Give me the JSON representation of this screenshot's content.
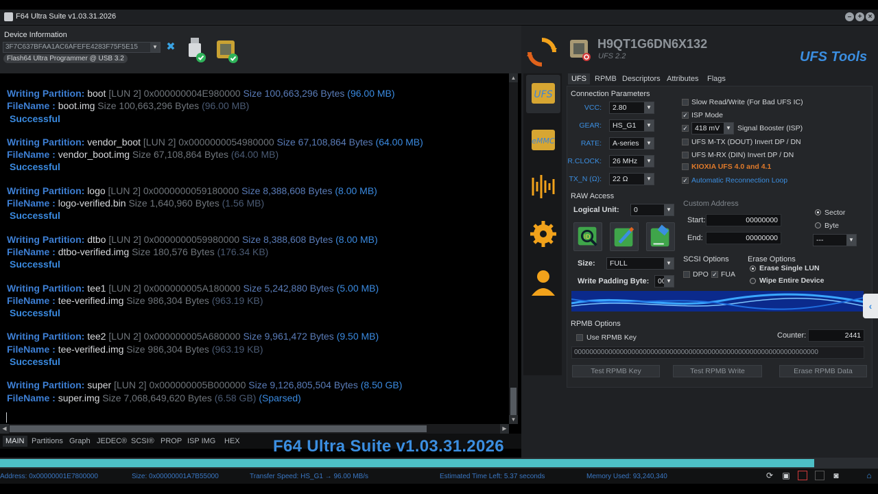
{
  "window": {
    "title": "F64 Ultra Suite v1.03.31.2026"
  },
  "device_info": {
    "label": "Device Information",
    "device_id": "3F7C637BFAA1AC6AFEFE4283F75F5E15",
    "programmer": "Flash64 Ultra Programmer @ USB 3.2"
  },
  "log": {
    "entries": [
      {
        "label": "Writing Partition:",
        "name": "boot",
        "details": "[LUN 2] 0x000000004E980000",
        "size_text": "Size 100,663,296 Bytes",
        "size_human": "(96.00 MB)",
        "file_label": "FileName :",
        "file": "boot.img",
        "file_size": "Size 100,663,296 Bytes",
        "file_human": "(96.00 MB)",
        "status": "Successful",
        "sparsed": ""
      },
      {
        "label": "Writing Partition:",
        "name": "vendor_boot",
        "details": "[LUN 2] 0x0000000054980000",
        "size_text": "Size 67,108,864 Bytes",
        "size_human": "(64.00 MB)",
        "file_label": "FileName :",
        "file": "vendor_boot.img",
        "file_size": "Size 67,108,864 Bytes",
        "file_human": "(64.00 MB)",
        "status": "Successful",
        "sparsed": ""
      },
      {
        "label": "Writing Partition:",
        "name": "logo",
        "details": "[LUN 2] 0x0000000059180000",
        "size_text": "Size 8,388,608 Bytes",
        "size_human": "(8.00 MB)",
        "file_label": "FileName :",
        "file": "logo-verified.bin",
        "file_size": "Size 1,640,960 Bytes",
        "file_human": "(1.56 MB)",
        "status": "Successful",
        "sparsed": ""
      },
      {
        "label": "Writing Partition:",
        "name": "dtbo",
        "details": "[LUN 2] 0x0000000059980000",
        "size_text": "Size 8,388,608 Bytes",
        "size_human": "(8.00 MB)",
        "file_label": "FileName :",
        "file": "dtbo-verified.img",
        "file_size": "Size 180,576 Bytes",
        "file_human": "(176.34 KB)",
        "status": "Successful",
        "sparsed": ""
      },
      {
        "label": "Writing Partition:",
        "name": "tee1",
        "details": "[LUN 2] 0x000000005A180000",
        "size_text": "Size 5,242,880 Bytes",
        "size_human": "(5.00 MB)",
        "file_label": "FileName :",
        "file": "tee-verified.img",
        "file_size": "Size 986,304 Bytes",
        "file_human": "(963.19 KB)",
        "status": "Successful",
        "sparsed": ""
      },
      {
        "label": "Writing Partition:",
        "name": "tee2",
        "details": "[LUN 2] 0x000000005A680000",
        "size_text": "Size 9,961,472 Bytes",
        "size_human": "(9.50 MB)",
        "file_label": "FileName :",
        "file": "tee-verified.img",
        "file_size": "Size 986,304 Bytes",
        "file_human": "(963.19 KB)",
        "status": "Successful",
        "sparsed": ""
      },
      {
        "label": "Writing Partition:",
        "name": "super",
        "details": "[LUN 2] 0x000000005B000000",
        "size_text": "Size 9,126,805,504 Bytes",
        "size_human": "(8.50 GB)",
        "file_label": "FileName :",
        "file": "super.img",
        "file_size": "Size 7,068,649,620 Bytes",
        "file_human": "(6.58 GB)",
        "status": "",
        "sparsed": "(Sparsed)"
      }
    ]
  },
  "bottom_tabs": [
    "MAIN",
    "Partitions",
    "Graph",
    "JEDEC®",
    "SCSI®",
    "PROP",
    "ISP IMG",
    "HEX"
  ],
  "brand": "F64 Ultra Suite v1.03.31.2026",
  "progress": {
    "fraction": 0.927,
    "color": "#4dbfc6"
  },
  "status": {
    "address": "Address: 0x00000001E7800000",
    "size": "Size: 0x00000001A7B55000",
    "speed": "Transfer Speed:  HS_G1 → 96.00 MB/s",
    "eta": "Estimated Time Left: 5.37 seconds",
    "memory": "Memory Used: 93,240,340"
  },
  "device": {
    "name": "H9QT1G6DN6X132",
    "sub": "UFS 2.2",
    "tool_title": "UFS Tools"
  },
  "tabs": [
    "UFS",
    "RPMB",
    "Descriptors",
    "Attributes",
    "Flags"
  ],
  "connection": {
    "title": "Connection Parameters",
    "params": [
      {
        "label": "VCC:",
        "value": "2.80"
      },
      {
        "label": "GEAR:",
        "value": "HS_G1"
      },
      {
        "label": "RATE:",
        "value": "A-series"
      },
      {
        "label": "R.CLOCK:",
        "value": "26 MHz"
      },
      {
        "label": "TX_N (Ω):",
        "value": "22 Ω"
      }
    ],
    "options": [
      {
        "label": "Slow Read/Write (For Bad UFS IC)",
        "checked": false,
        "style": ""
      },
      {
        "label": "ISP Mode",
        "checked": true,
        "style": ""
      },
      {
        "label": "Signal Booster (ISP)",
        "checked": true,
        "style": ""
      },
      {
        "label": "UFS M-TX (DOUT) Invert DP / DN",
        "checked": false,
        "style": ""
      },
      {
        "label": "UFS M-RX (DIN) Invert DP / DN",
        "checked": false,
        "style": ""
      },
      {
        "label": "KIOXIA UFS 4.0 and 4.1",
        "checked": false,
        "style": "warn"
      },
      {
        "label": "Automatic Reconnection Loop",
        "checked": true,
        "style": "blue"
      }
    ],
    "booster_value": "418 mV"
  },
  "raw": {
    "title": "RAW Access",
    "lu_label": "Logical Unit:",
    "lu_value": "0",
    "size_label": "Size:",
    "size_value": "FULL",
    "pad_label": "Write Padding Byte:",
    "pad_value": "00",
    "custom_title": "Custom Address",
    "start_label": "Start:",
    "start_value": "00000000",
    "end_label": "End:",
    "end_value": "00000000",
    "unit_sector": "Sector",
    "unit_byte": "Byte",
    "unit_combo": "---",
    "scsi_title": "SCSI Options",
    "dpo": "DPO",
    "fua": "FUA",
    "erase_title": "Erase Options",
    "erase_single": "Erase Single LUN",
    "wipe": "Wipe Entire Device"
  },
  "rpmb": {
    "title": "RPMB Options",
    "use_key": "Use RPMB Key",
    "counter_label": "Counter:",
    "counter_value": "2441",
    "key_value": "0000000000000000000000000000000000000000000000000000000000000000",
    "btn_test_key": "Test RPMB Key",
    "btn_test_write": "Test RPMB Write",
    "btn_erase": "Erase RPMB Data"
  },
  "icons": {
    "side": [
      "ufs-icon",
      "emmc-icon",
      "waveform-icon",
      "gear-icon",
      "user-icon"
    ],
    "tools": [
      "chip-id-icon",
      "write-icon",
      "erase-icon"
    ]
  },
  "colors": {
    "accent": "#3b8ee0",
    "warn": "#e07a2a",
    "progress": "#4dbfc6"
  }
}
